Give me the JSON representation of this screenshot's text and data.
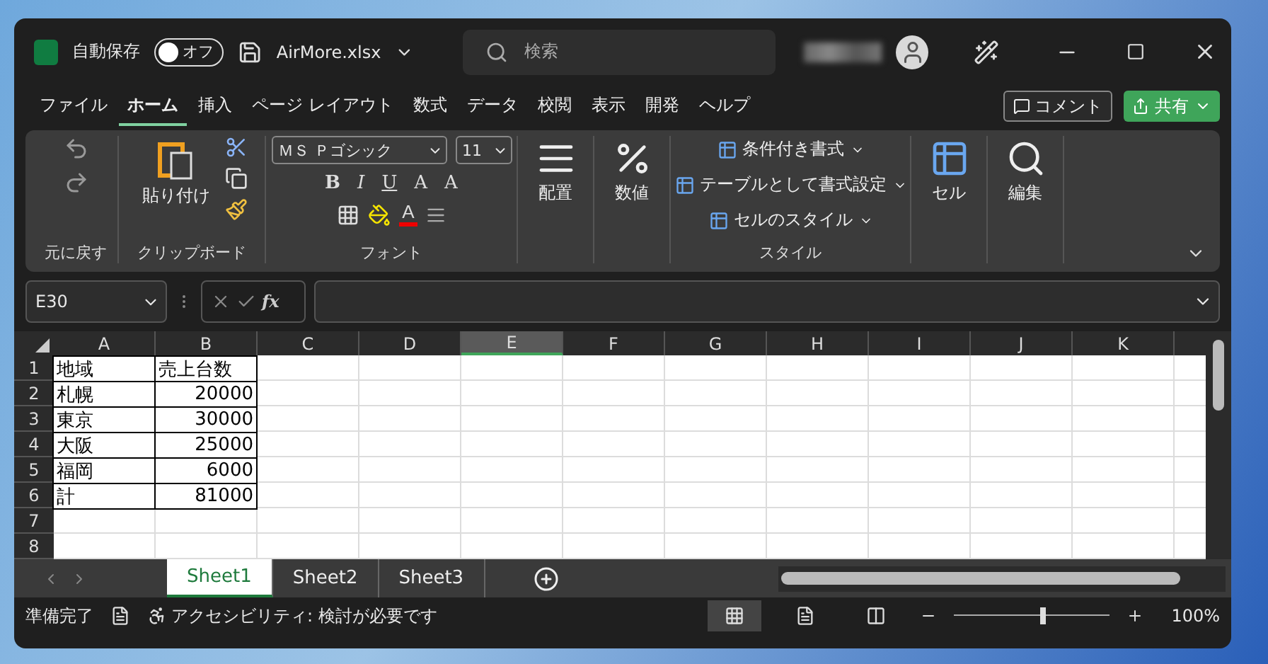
{
  "title_bar": {
    "autosave_label": "自動保存",
    "autosave_toggle": {
      "label": "オフ",
      "on": false
    },
    "file_name": "AirMore.xlsx",
    "search": {
      "placeholder": "検索"
    }
  },
  "menu_tabs": [
    {
      "label": "ファイル",
      "selected": false
    },
    {
      "label": "ホーム",
      "selected": true
    },
    {
      "label": "挿入",
      "selected": false
    },
    {
      "label": "ページ レイアウト",
      "selected": false
    },
    {
      "label": "数式",
      "selected": false
    },
    {
      "label": "データ",
      "selected": false
    },
    {
      "label": "校閲",
      "selected": false
    },
    {
      "label": "表示",
      "selected": false
    },
    {
      "label": "開発",
      "selected": false
    },
    {
      "label": "ヘルプ",
      "selected": false
    }
  ],
  "comment_button": "コメント",
  "share_button": "共有",
  "ribbon": {
    "undo_group": "元に戻す",
    "clipboard_group": "クリップボード",
    "paste": "貼り付け",
    "font_group": "フォント",
    "font_name": "ＭＳ Ｐゴシック",
    "font_size": "11",
    "bold": "B",
    "italic": "I",
    "underline": "U",
    "grow_font": "A",
    "shrink_font": "A",
    "font_color": "A",
    "alignment": "配置",
    "number": "数値",
    "style_items": [
      "条件付き書式",
      "テーブルとして書式設定",
      "セルのスタイル"
    ],
    "style_group": "スタイル",
    "cells": "セル",
    "editing": "編集"
  },
  "formula_bar": {
    "name_box": "E30",
    "function_label": "fx"
  },
  "sheet": {
    "columns": [
      {
        "label": "A",
        "selected": false
      },
      {
        "label": "B",
        "selected": false
      },
      {
        "label": "C",
        "selected": false
      },
      {
        "label": "D",
        "selected": false
      },
      {
        "label": "E",
        "selected": true
      },
      {
        "label": "F",
        "selected": false
      },
      {
        "label": "G",
        "selected": false
      },
      {
        "label": "H",
        "selected": false
      },
      {
        "label": "I",
        "selected": false
      },
      {
        "label": "J",
        "selected": false
      },
      {
        "label": "K",
        "selected": false
      }
    ],
    "rows": [
      {
        "header": "1",
        "cells": [
          {
            "text": "地域",
            "kind": "text"
          },
          {
            "text": "売上台数",
            "kind": "text"
          }
        ]
      },
      {
        "header": "2",
        "cells": [
          {
            "text": "札幌",
            "kind": "text"
          },
          {
            "text": "20000",
            "kind": "number"
          }
        ]
      },
      {
        "header": "3",
        "cells": [
          {
            "text": "東京",
            "kind": "text"
          },
          {
            "text": "30000",
            "kind": "number"
          }
        ]
      },
      {
        "header": "4",
        "cells": [
          {
            "text": "大阪",
            "kind": "text"
          },
          {
            "text": "25000",
            "kind": "number"
          }
        ]
      },
      {
        "header": "5",
        "cells": [
          {
            "text": "福岡",
            "kind": "text"
          },
          {
            "text": "6000",
            "kind": "number"
          }
        ]
      },
      {
        "header": "6",
        "cells": [
          {
            "text": "計",
            "kind": "text"
          },
          {
            "text": "81000",
            "kind": "number"
          }
        ]
      },
      {
        "header": "7",
        "cells": []
      },
      {
        "header": "8",
        "cells": []
      }
    ]
  },
  "sheet_tabs": [
    {
      "label": "Sheet1",
      "selected": true
    },
    {
      "label": "Sheet2",
      "selected": false
    },
    {
      "label": "Sheet3",
      "selected": false
    }
  ],
  "status_bar": {
    "status": "準備完了",
    "accessibility": "アクセシビリティ: 検討が必要です",
    "views": [
      {
        "selected": true
      },
      {
        "selected": false
      },
      {
        "selected": false
      }
    ],
    "zoom": {
      "level": 0.58,
      "reading": "100%"
    }
  }
}
